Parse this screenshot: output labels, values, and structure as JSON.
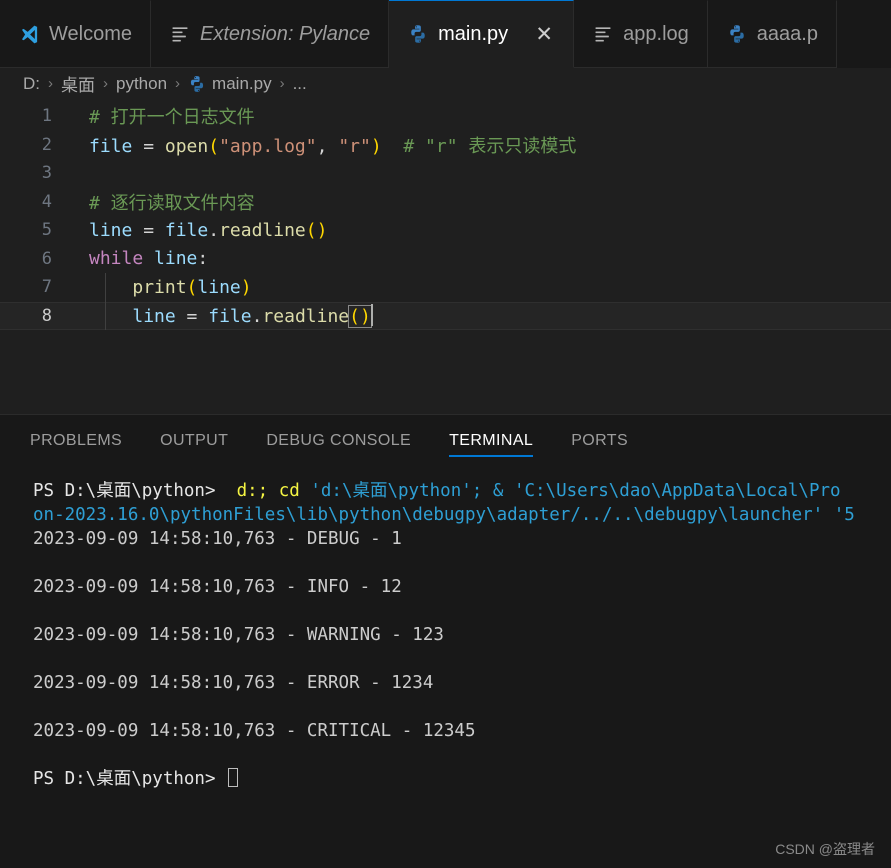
{
  "window": {
    "theme": "dark",
    "colors": {
      "editor_background": "#1f1f1f",
      "panel_background": "#181818",
      "tabbar_background": "#181818",
      "accent": "#0078d4",
      "active_tab_border": "#0078d4",
      "comment": "#6A9955",
      "keyword": "#C586C0",
      "variable": "#9CDCFE",
      "function": "#DCDCAA",
      "string": "#CE9178",
      "bracket": "#FFD700",
      "terminal_yellow": "#f5f543",
      "terminal_cyan": "#2e9fd4"
    }
  },
  "tabs": [
    {
      "label": "Welcome",
      "icon": "vscode-logo-icon",
      "active": false,
      "italic": false,
      "closable": false
    },
    {
      "label": "Extension: Pylance",
      "icon": "file-lines-icon",
      "active": false,
      "italic": true,
      "closable": false
    },
    {
      "label": "main.py",
      "icon": "python-icon",
      "active": true,
      "italic": false,
      "closable": true,
      "close_label": "✕"
    },
    {
      "label": "app.log",
      "icon": "file-lines-icon",
      "active": false,
      "italic": false,
      "closable": false
    },
    {
      "label": "aaaa.p",
      "icon": "python-icon",
      "active": false,
      "italic": false,
      "closable": false
    }
  ],
  "breadcrumb": {
    "separator": "›",
    "items": [
      {
        "label": "D:",
        "icon": null
      },
      {
        "label": "桌面",
        "icon": null
      },
      {
        "label": "python",
        "icon": null
      },
      {
        "label": "main.py",
        "icon": "python-icon"
      },
      {
        "label": "...",
        "icon": null
      }
    ]
  },
  "editor": {
    "filename": "main.py",
    "language": "python",
    "active_line": 8,
    "cursor": {
      "line": 8,
      "column": 28
    },
    "lines": [
      {
        "num": "1",
        "indent_guide": false,
        "tokens": [
          {
            "t": "# 打开一个日志文件",
            "c": "cm"
          }
        ]
      },
      {
        "num": "2",
        "indent_guide": false,
        "tokens": [
          {
            "t": "file",
            "c": "var"
          },
          {
            "t": " = ",
            "c": "op"
          },
          {
            "t": "open",
            "c": "fn"
          },
          {
            "t": "(",
            "c": "paren"
          },
          {
            "t": "\"app.log\"",
            "c": "str"
          },
          {
            "t": ", ",
            "c": "plain"
          },
          {
            "t": "\"r\"",
            "c": "str"
          },
          {
            "t": ")",
            "c": "paren"
          },
          {
            "t": "  # \"r\" 表示只读模式",
            "c": "cm"
          }
        ]
      },
      {
        "num": "3",
        "indent_guide": false,
        "tokens": []
      },
      {
        "num": "4",
        "indent_guide": false,
        "tokens": [
          {
            "t": "# 逐行读取文件内容",
            "c": "cm"
          }
        ]
      },
      {
        "num": "5",
        "indent_guide": false,
        "tokens": [
          {
            "t": "line",
            "c": "var"
          },
          {
            "t": " = ",
            "c": "op"
          },
          {
            "t": "file",
            "c": "var"
          },
          {
            "t": ".",
            "c": "plain"
          },
          {
            "t": "readline",
            "c": "fn"
          },
          {
            "t": "()",
            "c": "paren"
          }
        ]
      },
      {
        "num": "6",
        "indent_guide": false,
        "tokens": [
          {
            "t": "while",
            "c": "kw"
          },
          {
            "t": " ",
            "c": "plain"
          },
          {
            "t": "line",
            "c": "var"
          },
          {
            "t": ":",
            "c": "plain"
          }
        ]
      },
      {
        "num": "7",
        "indent_guide": true,
        "tokens": [
          {
            "t": "    ",
            "c": "plain"
          },
          {
            "t": "print",
            "c": "fn"
          },
          {
            "t": "(",
            "c": "paren"
          },
          {
            "t": "line",
            "c": "var"
          },
          {
            "t": ")",
            "c": "paren"
          }
        ]
      },
      {
        "num": "8",
        "indent_guide": true,
        "active": true,
        "tokens": [
          {
            "t": "    ",
            "c": "plain"
          },
          {
            "t": "line",
            "c": "var"
          },
          {
            "t": " = ",
            "c": "op"
          },
          {
            "t": "file",
            "c": "var"
          },
          {
            "t": ".",
            "c": "plain"
          },
          {
            "t": "readline",
            "c": "fn"
          },
          {
            "t": "()",
            "c": "paren",
            "boxed": true
          }
        ]
      }
    ]
  },
  "panel": {
    "tabs": [
      {
        "label": "PROBLEMS",
        "active": false
      },
      {
        "label": "OUTPUT",
        "active": false
      },
      {
        "label": "DEBUG CONSOLE",
        "active": false
      },
      {
        "label": "TERMINAL",
        "active": true
      },
      {
        "label": "PORTS",
        "active": false
      }
    ],
    "terminal": {
      "lines": [
        {
          "segments": [
            {
              "t": "PS D:\\桌面\\python> ",
              "c": "t-white"
            },
            {
              "t": " d:; ",
              "c": "t-yellow"
            },
            {
              "t": "cd ",
              "c": "t-yellow"
            },
            {
              "t": "'d:\\桌面\\python'",
              "c": "t-cyan"
            },
            {
              "t": "; & ",
              "c": "t-cyan"
            },
            {
              "t": "'C:\\Users\\dao\\AppData\\Local\\Pro",
              "c": "t-cyan"
            }
          ]
        },
        {
          "segments": [
            {
              "t": "on-2023.16.0\\pythonFiles\\lib\\python\\debugpy\\adapter/../..\\debugpy\\launcher' '5",
              "c": "t-cyan"
            }
          ]
        },
        {
          "segments": [
            {
              "t": "2023-09-09 14:58:10,763 - DEBUG - 1",
              "c": "t-log"
            }
          ]
        },
        {
          "segments": []
        },
        {
          "segments": [
            {
              "t": "2023-09-09 14:58:10,763 - INFO - 12",
              "c": "t-log"
            }
          ]
        },
        {
          "segments": []
        },
        {
          "segments": [
            {
              "t": "2023-09-09 14:58:10,763 - WARNING - 123",
              "c": "t-log"
            }
          ]
        },
        {
          "segments": []
        },
        {
          "segments": [
            {
              "t": "2023-09-09 14:58:10,763 - ERROR - 1234",
              "c": "t-log"
            }
          ]
        },
        {
          "segments": []
        },
        {
          "segments": [
            {
              "t": "2023-09-09 14:58:10,763 - CRITICAL - 12345",
              "c": "t-log"
            }
          ]
        },
        {
          "segments": []
        },
        {
          "segments": [
            {
              "t": "PS D:\\桌面\\python> ",
              "c": "t-white"
            },
            {
              "t": "",
              "c": "caret-block"
            }
          ]
        }
      ]
    }
  },
  "watermark": {
    "text": "CSDN @盗理者"
  }
}
